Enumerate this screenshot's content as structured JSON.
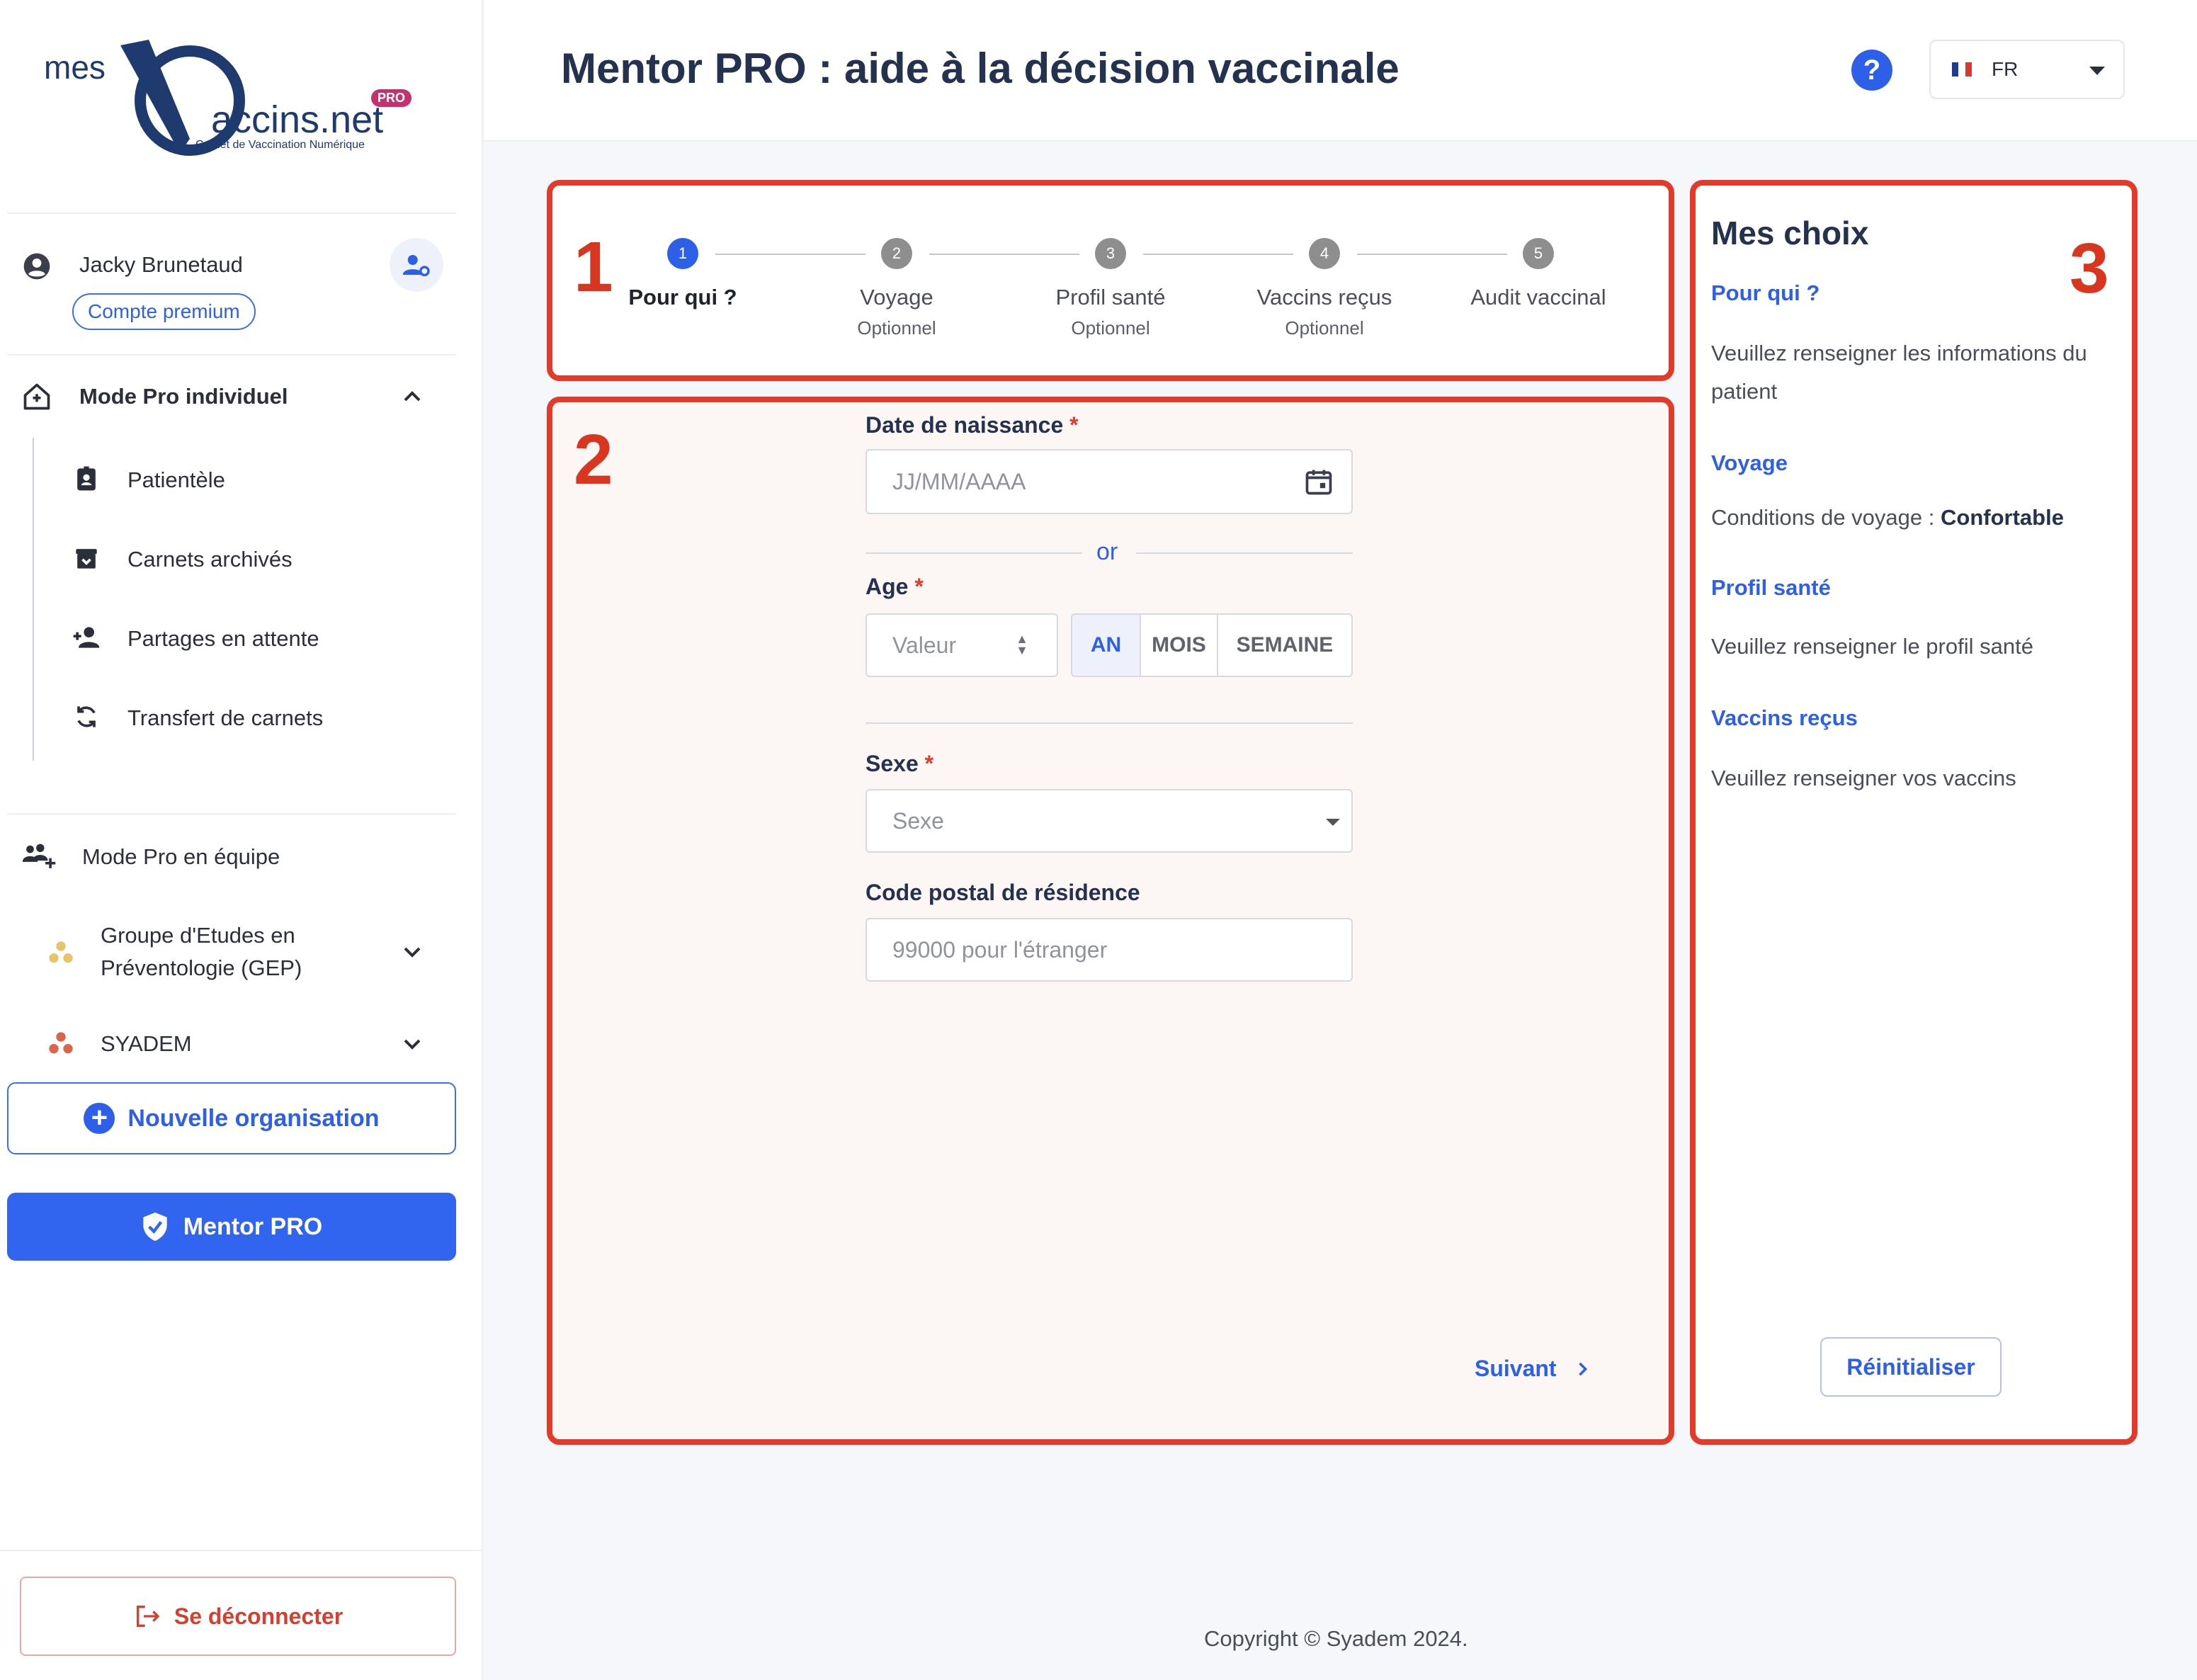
{
  "logo": {
    "mes": "mes",
    "vaccins": "accins.net",
    "pro": "PRO",
    "subtitle": "Carnet de Vaccination Numérique"
  },
  "user": {
    "name": "Jacky Brunetaud",
    "badge": "Compte premium"
  },
  "sidebar": {
    "mode_individuel": "Mode Pro individuel",
    "items": [
      {
        "label": "Patientèle",
        "icon": "id-badge-icon"
      },
      {
        "label": "Carnets archivés",
        "icon": "archive-icon"
      },
      {
        "label": "Partages en attente",
        "icon": "person-add-icon"
      },
      {
        "label": "Transfert de carnets",
        "icon": "sync-icon"
      }
    ],
    "mode_equipe": "Mode Pro en équipe",
    "orgs": [
      {
        "label_line1": "Groupe d'Etudes en",
        "label_line2": "Préventologie (GEP)",
        "color": "#e8c36b"
      },
      {
        "label_line1": "SYADEM",
        "label_line2": "",
        "color": "#d9664a"
      }
    ],
    "new_org": "Nouvelle organisation",
    "mentor": "Mentor PRO",
    "logout": "Se déconnecter"
  },
  "header": {
    "title": "Mentor PRO : aide à la décision vaccinale",
    "help": "?",
    "lang": "FR"
  },
  "annotations": [
    "1",
    "2",
    "3"
  ],
  "stepper": [
    {
      "num": "1",
      "label": "Pour qui ?",
      "sub": "",
      "active": true
    },
    {
      "num": "2",
      "label": "Voyage",
      "sub": "Optionnel",
      "active": false
    },
    {
      "num": "3",
      "label": "Profil santé",
      "sub": "Optionnel",
      "active": false
    },
    {
      "num": "4",
      "label": "Vaccins reçus",
      "sub": "Optionnel",
      "active": false
    },
    {
      "num": "5",
      "label": "Audit vaccinal",
      "sub": "",
      "active": false
    }
  ],
  "form": {
    "dob_label": "Date de naissance",
    "dob_placeholder": "JJ/MM/AAAA",
    "or": "or",
    "age_label": "Age",
    "age_placeholder": "Valeur",
    "units": [
      "AN",
      "MOIS",
      "SEMAINE"
    ],
    "selected_unit": "AN",
    "sex_label": "Sexe",
    "sex_placeholder": "Sexe",
    "postal_label": "Code postal de résidence",
    "postal_placeholder": "99000 pour l'étranger",
    "required_mark": "*",
    "next": "Suivant"
  },
  "choices": {
    "title": "Mes choix",
    "sections": [
      {
        "head": "Pour qui ?",
        "text": "Veuillez renseigner les informations du patient"
      },
      {
        "head": "Voyage",
        "text_prefix": "Conditions de voyage : ",
        "text_value": "Confortable"
      },
      {
        "head": "Profil santé",
        "text": "Veuillez renseigner le profil santé"
      },
      {
        "head": "Vaccins reçus",
        "text": "Veuillez renseigner vos vaccins"
      }
    ],
    "reset": "Réinitialiser"
  },
  "footer": "Copyright © Syadem 2024.",
  "colors": {
    "accent": "#2d5fe8",
    "annotation": "#e23b2a",
    "danger": "#d2402f"
  }
}
